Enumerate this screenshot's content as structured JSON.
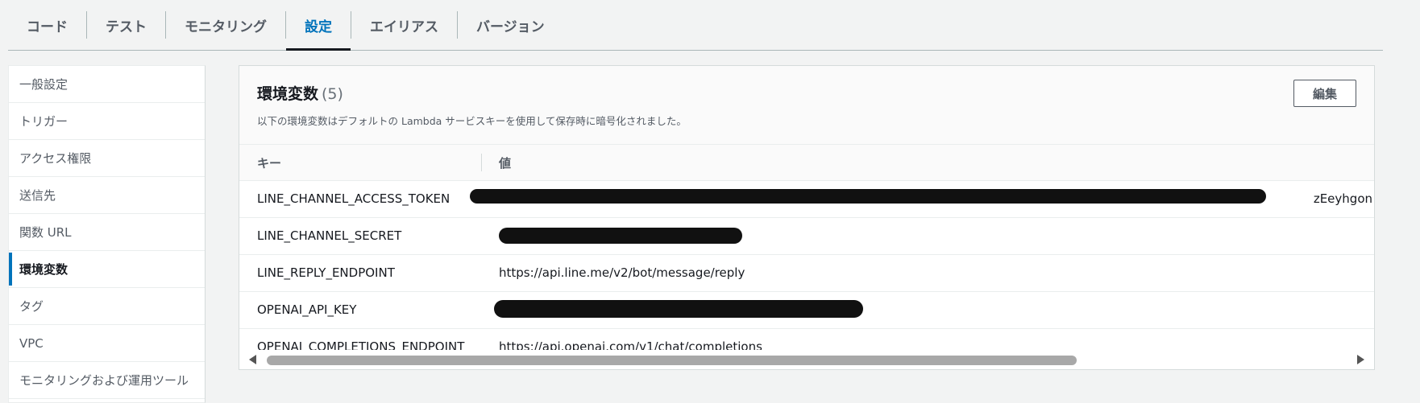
{
  "tabs": [
    {
      "label": "コード"
    },
    {
      "label": "テスト"
    },
    {
      "label": "モニタリング"
    },
    {
      "label": "設定",
      "active": true
    },
    {
      "label": "エイリアス"
    },
    {
      "label": "バージョン"
    }
  ],
  "sidebar": {
    "items": [
      {
        "label": "一般設定"
      },
      {
        "label": "トリガー"
      },
      {
        "label": "アクセス権限"
      },
      {
        "label": "送信先"
      },
      {
        "label": "関数 URL"
      },
      {
        "label": "環境変数",
        "active": true
      },
      {
        "label": "タグ"
      },
      {
        "label": "VPC"
      },
      {
        "label": "モニタリングおよび運用ツール"
      }
    ]
  },
  "panel": {
    "title": "環境変数",
    "count": "(5)",
    "description": "以下の環境変数はデフォルトの Lambda サービスキーを使用して保存時に暗号化されました。",
    "edit_label": "編集",
    "columns": {
      "key": "キー",
      "value": "値"
    },
    "rows": [
      {
        "key": "LINE_CHANNEL_ACCESS_TOKEN",
        "value": "",
        "redacted": true,
        "partial_visible_suffix": "zEeyhgon"
      },
      {
        "key": "LINE_CHANNEL_SECRET",
        "value": "",
        "redacted": true
      },
      {
        "key": "LINE_REPLY_ENDPOINT",
        "value": "https://api.line.me/v2/bot/message/reply"
      },
      {
        "key": "OPENAI_API_KEY",
        "value": "",
        "redacted": true
      },
      {
        "key": "OPENAI_COMPLETIONS_ENDPOINT",
        "value": "https://api.openai.com/v1/chat/completions"
      }
    ]
  },
  "colors": {
    "accent": "#0073bb",
    "text": "#16191f",
    "muted": "#545b64",
    "background": "#f2f3f3"
  }
}
